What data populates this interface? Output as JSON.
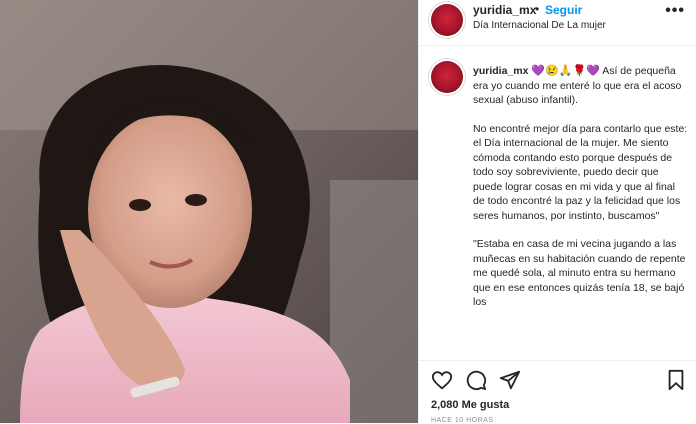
{
  "post": {
    "image_alt": "photo-of-girl"
  },
  "header": {
    "username": "yuridia_mx",
    "separator": "•",
    "follow_label": "Seguir",
    "location": "Día Internacional De La mujer",
    "more_label": "•••"
  },
  "caption": {
    "username": "yuridia_mx",
    "emojis": "💜😢🙏🌹💜",
    "p1": "Así de pequeña era yo cuando me enteré lo que era el acoso sexual (abuso infantil).",
    "p2": "No encontré mejor día para contarlo que este: el Día internacional de la mujer. Me siento cómoda contando esto porque después de todo soy sobreviviente, puedo decir que puede lograr cosas en mi vida y que al final de todo encontré la paz y la felicidad que los seres humanos, por instinto, buscamos\"",
    "p3": "\"Estaba en casa de mi vecina jugando a las muñecas en su habitación cuando de repente me quedé sola, al minuto entra su hermano que en ese entonces quizás tenía 18, se bajó los"
  },
  "actions": {
    "like_icon": "heart-icon",
    "comment_icon": "comment-icon",
    "share_icon": "share-icon",
    "save_icon": "bookmark-icon",
    "likes": "2,080 Me gusta",
    "timestamp": "HACE 10 HORAS"
  },
  "colors": {
    "accent": "#0095f6",
    "text": "#262626",
    "muted": "#8e8e8e"
  }
}
